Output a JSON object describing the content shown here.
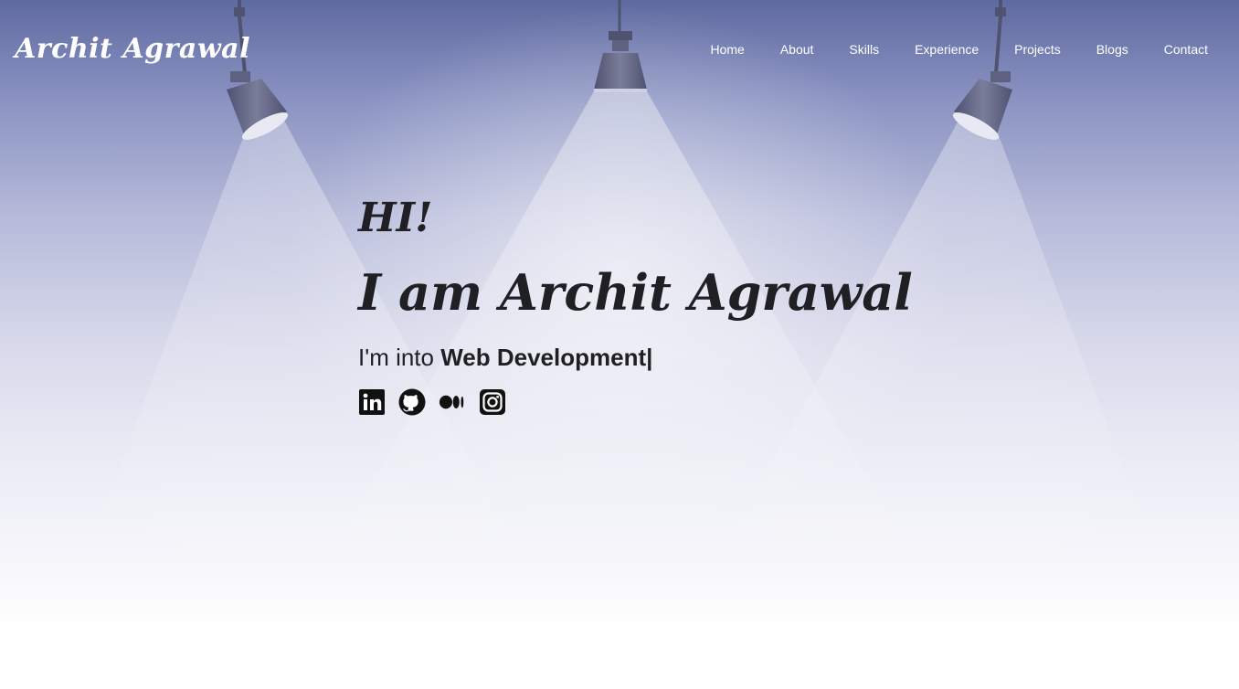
{
  "brand": {
    "name": "Archit Agrawal"
  },
  "nav": {
    "items": [
      {
        "label": "Home"
      },
      {
        "label": "About"
      },
      {
        "label": "Skills"
      },
      {
        "label": "Experience"
      },
      {
        "label": "Projects"
      },
      {
        "label": "Blogs"
      },
      {
        "label": "Contact"
      }
    ]
  },
  "hero": {
    "greeting": "HI!",
    "headline": "I am Archit Agrawal",
    "tagline_prefix": "I'm into ",
    "tagline_highlight": "Web Development",
    "cursor": "|"
  },
  "socials": [
    {
      "icon": "linkedin-icon"
    },
    {
      "icon": "github-icon"
    },
    {
      "icon": "medium-icon"
    },
    {
      "icon": "instagram-icon"
    }
  ],
  "colors": {
    "text_dark": "#1f1f24",
    "nav_text": "#ffffff",
    "sky_top": "#5f6aa0",
    "lamp": "#5e6180"
  }
}
